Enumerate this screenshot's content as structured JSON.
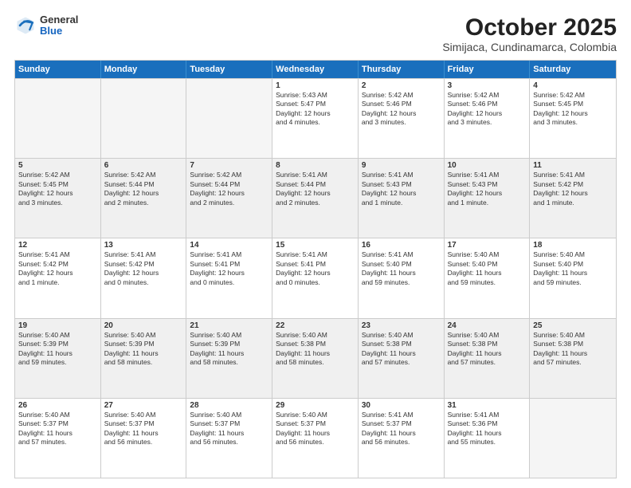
{
  "header": {
    "logo_general": "General",
    "logo_blue": "Blue",
    "month_title": "October 2025",
    "location": "Simijaca, Cundinamarca, Colombia"
  },
  "weekdays": [
    "Sunday",
    "Monday",
    "Tuesday",
    "Wednesday",
    "Thursday",
    "Friday",
    "Saturday"
  ],
  "rows": [
    [
      {
        "day": "",
        "lines": [],
        "empty": true
      },
      {
        "day": "",
        "lines": [],
        "empty": true
      },
      {
        "day": "",
        "lines": [],
        "empty": true
      },
      {
        "day": "1",
        "lines": [
          "Sunrise: 5:43 AM",
          "Sunset: 5:47 PM",
          "Daylight: 12 hours",
          "and 4 minutes."
        ]
      },
      {
        "day": "2",
        "lines": [
          "Sunrise: 5:42 AM",
          "Sunset: 5:46 PM",
          "Daylight: 12 hours",
          "and 3 minutes."
        ]
      },
      {
        "day": "3",
        "lines": [
          "Sunrise: 5:42 AM",
          "Sunset: 5:46 PM",
          "Daylight: 12 hours",
          "and 3 minutes."
        ]
      },
      {
        "day": "4",
        "lines": [
          "Sunrise: 5:42 AM",
          "Sunset: 5:45 PM",
          "Daylight: 12 hours",
          "and 3 minutes."
        ]
      }
    ],
    [
      {
        "day": "5",
        "lines": [
          "Sunrise: 5:42 AM",
          "Sunset: 5:45 PM",
          "Daylight: 12 hours",
          "and 3 minutes."
        ],
        "shaded": true
      },
      {
        "day": "6",
        "lines": [
          "Sunrise: 5:42 AM",
          "Sunset: 5:44 PM",
          "Daylight: 12 hours",
          "and 2 minutes."
        ],
        "shaded": true
      },
      {
        "day": "7",
        "lines": [
          "Sunrise: 5:42 AM",
          "Sunset: 5:44 PM",
          "Daylight: 12 hours",
          "and 2 minutes."
        ],
        "shaded": true
      },
      {
        "day": "8",
        "lines": [
          "Sunrise: 5:41 AM",
          "Sunset: 5:44 PM",
          "Daylight: 12 hours",
          "and 2 minutes."
        ],
        "shaded": true
      },
      {
        "day": "9",
        "lines": [
          "Sunrise: 5:41 AM",
          "Sunset: 5:43 PM",
          "Daylight: 12 hours",
          "and 1 minute."
        ],
        "shaded": true
      },
      {
        "day": "10",
        "lines": [
          "Sunrise: 5:41 AM",
          "Sunset: 5:43 PM",
          "Daylight: 12 hours",
          "and 1 minute."
        ],
        "shaded": true
      },
      {
        "day": "11",
        "lines": [
          "Sunrise: 5:41 AM",
          "Sunset: 5:42 PM",
          "Daylight: 12 hours",
          "and 1 minute."
        ],
        "shaded": true
      }
    ],
    [
      {
        "day": "12",
        "lines": [
          "Sunrise: 5:41 AM",
          "Sunset: 5:42 PM",
          "Daylight: 12 hours",
          "and 1 minute."
        ]
      },
      {
        "day": "13",
        "lines": [
          "Sunrise: 5:41 AM",
          "Sunset: 5:42 PM",
          "Daylight: 12 hours",
          "and 0 minutes."
        ]
      },
      {
        "day": "14",
        "lines": [
          "Sunrise: 5:41 AM",
          "Sunset: 5:41 PM",
          "Daylight: 12 hours",
          "and 0 minutes."
        ]
      },
      {
        "day": "15",
        "lines": [
          "Sunrise: 5:41 AM",
          "Sunset: 5:41 PM",
          "Daylight: 12 hours",
          "and 0 minutes."
        ]
      },
      {
        "day": "16",
        "lines": [
          "Sunrise: 5:41 AM",
          "Sunset: 5:40 PM",
          "Daylight: 11 hours",
          "and 59 minutes."
        ]
      },
      {
        "day": "17",
        "lines": [
          "Sunrise: 5:40 AM",
          "Sunset: 5:40 PM",
          "Daylight: 11 hours",
          "and 59 minutes."
        ]
      },
      {
        "day": "18",
        "lines": [
          "Sunrise: 5:40 AM",
          "Sunset: 5:40 PM",
          "Daylight: 11 hours",
          "and 59 minutes."
        ]
      }
    ],
    [
      {
        "day": "19",
        "lines": [
          "Sunrise: 5:40 AM",
          "Sunset: 5:39 PM",
          "Daylight: 11 hours",
          "and 59 minutes."
        ],
        "shaded": true
      },
      {
        "day": "20",
        "lines": [
          "Sunrise: 5:40 AM",
          "Sunset: 5:39 PM",
          "Daylight: 11 hours",
          "and 58 minutes."
        ],
        "shaded": true
      },
      {
        "day": "21",
        "lines": [
          "Sunrise: 5:40 AM",
          "Sunset: 5:39 PM",
          "Daylight: 11 hours",
          "and 58 minutes."
        ],
        "shaded": true
      },
      {
        "day": "22",
        "lines": [
          "Sunrise: 5:40 AM",
          "Sunset: 5:38 PM",
          "Daylight: 11 hours",
          "and 58 minutes."
        ],
        "shaded": true
      },
      {
        "day": "23",
        "lines": [
          "Sunrise: 5:40 AM",
          "Sunset: 5:38 PM",
          "Daylight: 11 hours",
          "and 57 minutes."
        ],
        "shaded": true
      },
      {
        "day": "24",
        "lines": [
          "Sunrise: 5:40 AM",
          "Sunset: 5:38 PM",
          "Daylight: 11 hours",
          "and 57 minutes."
        ],
        "shaded": true
      },
      {
        "day": "25",
        "lines": [
          "Sunrise: 5:40 AM",
          "Sunset: 5:38 PM",
          "Daylight: 11 hours",
          "and 57 minutes."
        ],
        "shaded": true
      }
    ],
    [
      {
        "day": "26",
        "lines": [
          "Sunrise: 5:40 AM",
          "Sunset: 5:37 PM",
          "Daylight: 11 hours",
          "and 57 minutes."
        ]
      },
      {
        "day": "27",
        "lines": [
          "Sunrise: 5:40 AM",
          "Sunset: 5:37 PM",
          "Daylight: 11 hours",
          "and 56 minutes."
        ]
      },
      {
        "day": "28",
        "lines": [
          "Sunrise: 5:40 AM",
          "Sunset: 5:37 PM",
          "Daylight: 11 hours",
          "and 56 minutes."
        ]
      },
      {
        "day": "29",
        "lines": [
          "Sunrise: 5:40 AM",
          "Sunset: 5:37 PM",
          "Daylight: 11 hours",
          "and 56 minutes."
        ]
      },
      {
        "day": "30",
        "lines": [
          "Sunrise: 5:41 AM",
          "Sunset: 5:37 PM",
          "Daylight: 11 hours",
          "and 56 minutes."
        ]
      },
      {
        "day": "31",
        "lines": [
          "Sunrise: 5:41 AM",
          "Sunset: 5:36 PM",
          "Daylight: 11 hours",
          "and 55 minutes."
        ]
      },
      {
        "day": "",
        "lines": [],
        "empty": true
      }
    ]
  ]
}
